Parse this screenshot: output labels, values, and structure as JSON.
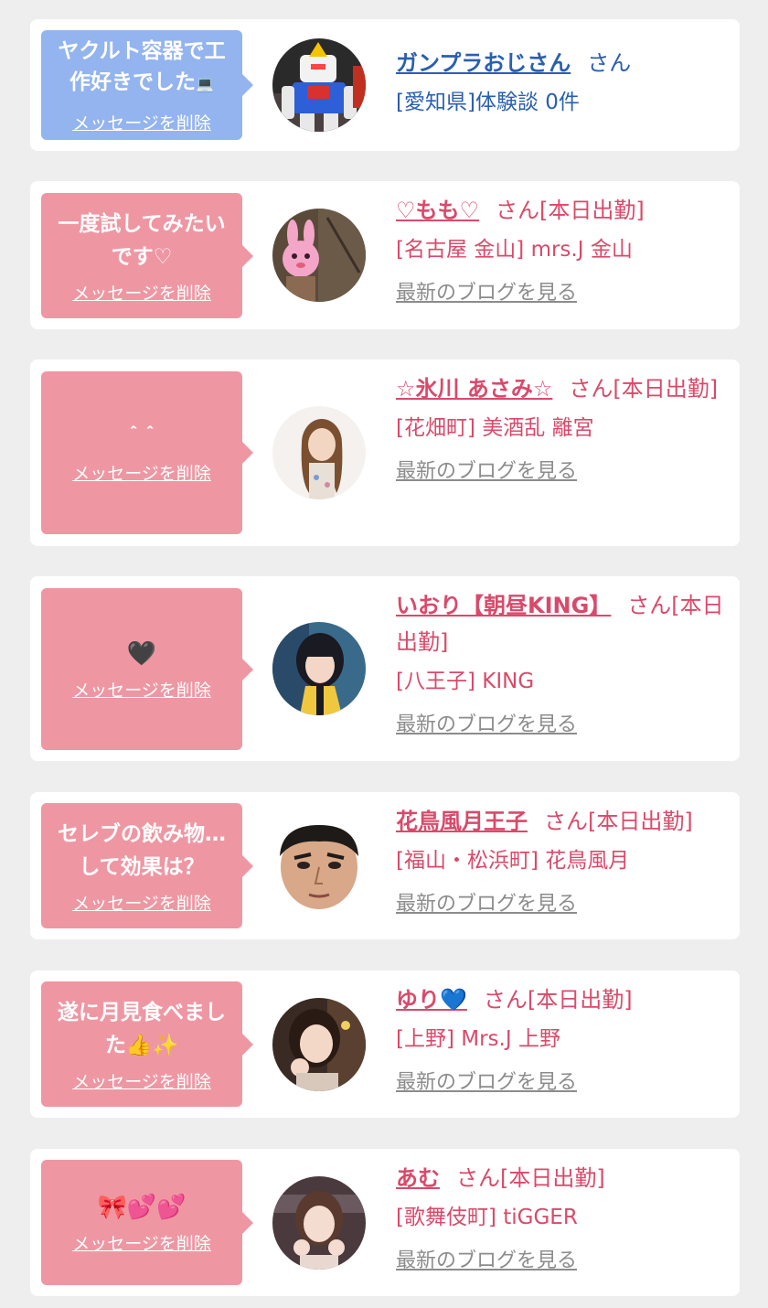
{
  "colors": {
    "background": "#eeeeee",
    "card": "#ffffff",
    "bubble_blue": "#93b4ee",
    "bubble_pink": "#ee97a3",
    "name_pink": "#d94a6a",
    "name_blue": "#2a5fb0",
    "blog_gray": "#8c8c8c"
  },
  "messages": [
    {
      "bubble_text": "ヤクルト容器で工作好きでした",
      "bubble_emoji": "💻",
      "delete_label": "メッセージを削除",
      "name": "ガンプラおじさん",
      "suffix": "さん",
      "shop": "[愛知県]体験談 0件",
      "avatar_icon": "gundam-robot-icon"
    },
    {
      "bubble_text": "一度試してみたいです♡",
      "delete_label": "メッセージを削除",
      "name": "♡もも♡",
      "suffix": "さん[本日出勤]",
      "shop": "[名古屋 金山] mrs.J 金山",
      "blog_label": "最新のブログを見る",
      "avatar_icon": "bunny-photo-icon"
    },
    {
      "bubble_text": "＾＾",
      "delete_label": "メッセージを削除",
      "name": "☆氷川 あさみ☆",
      "suffix": "さん[本日出勤]",
      "shop": "[花畑町] 美酒乱 離宮",
      "blog_label": "最新のブログを見る",
      "avatar_icon": "woman-portrait-icon"
    },
    {
      "bubble_text": "🖤",
      "delete_label": "メッセージを削除",
      "name": "いおり【朝昼KING】",
      "suffix": "さん[本日出勤]",
      "shop": "[八王子] KING",
      "blog_label": "最新のブログを見る",
      "avatar_icon": "woman-portrait-icon"
    },
    {
      "bubble_text": "セレブの飲み物…して効果は？",
      "delete_label": "メッセージを削除",
      "name": "花鳥風月王子",
      "suffix": "さん[本日出勤]",
      "shop": "[福山・松浜町] 花鳥風月",
      "blog_label": "最新のブログを見る",
      "avatar_icon": "man-face-icon"
    },
    {
      "bubble_text": "遂に月見食べました👍✨",
      "delete_label": "メッセージを削除",
      "name": "ゆり💙",
      "suffix": "さん[本日出勤]",
      "shop": "[上野] Mrs.J 上野",
      "blog_label": "最新のブログを見る",
      "avatar_icon": "woman-portrait-icon"
    },
    {
      "bubble_text": "🎀💕💕",
      "delete_label": "メッセージを削除",
      "name": "あむ",
      "suffix": "さん[本日出勤]",
      "shop": "[歌舞伎町] tiGGER",
      "blog_label": "最新のブログを見る",
      "avatar_icon": "woman-portrait-icon"
    }
  ]
}
